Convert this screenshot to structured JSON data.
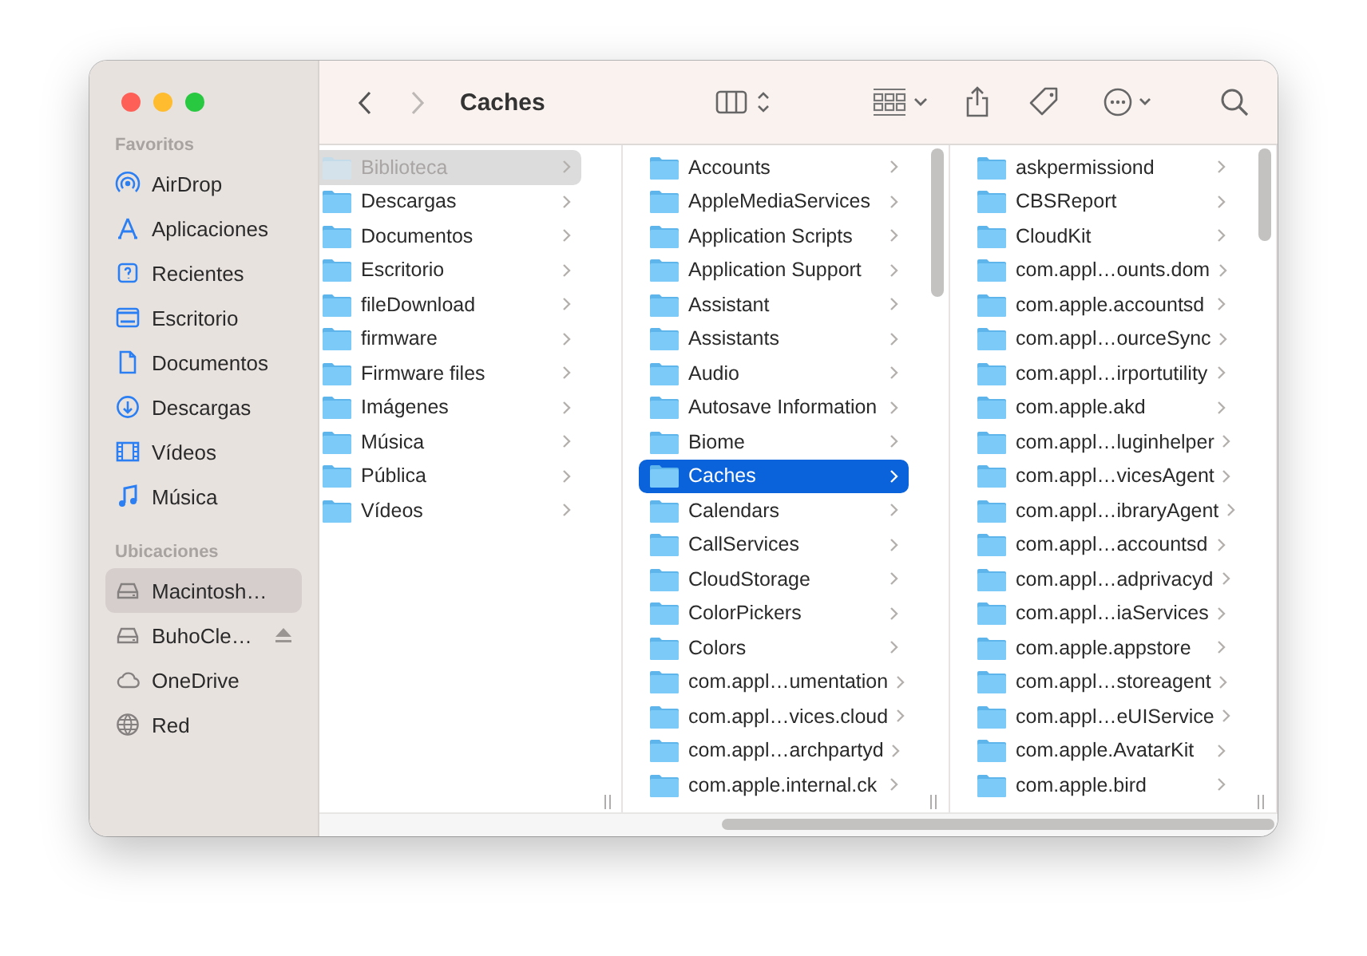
{
  "window": {
    "title": "Caches"
  },
  "toolbar": {
    "back": {
      "disabled": false
    },
    "forward": {
      "disabled": true
    }
  },
  "sidebar": {
    "sections": [
      {
        "heading": "Favoritos",
        "items": [
          {
            "label": "AirDrop",
            "selected": false,
            "ejectable": false
          },
          {
            "label": "Aplicaciones",
            "selected": false,
            "ejectable": false
          },
          {
            "label": "Recientes",
            "selected": false,
            "ejectable": false
          },
          {
            "label": "Escritorio",
            "selected": false,
            "ejectable": false
          },
          {
            "label": "Documentos",
            "selected": false,
            "ejectable": false
          },
          {
            "label": "Descargas",
            "selected": false,
            "ejectable": false
          },
          {
            "label": "Vídeos",
            "selected": false,
            "ejectable": false
          },
          {
            "label": "Música",
            "selected": false,
            "ejectable": false
          }
        ]
      },
      {
        "heading": "Ubicaciones",
        "items": [
          {
            "label": "Macintosh…",
            "selected": true,
            "ejectable": false
          },
          {
            "label": "BuhoCle…",
            "selected": false,
            "ejectable": true
          },
          {
            "label": "OneDrive",
            "selected": false,
            "ejectable": false
          },
          {
            "label": "Red",
            "selected": false,
            "ejectable": false
          }
        ]
      }
    ]
  },
  "columns": [
    {
      "focused": false,
      "items": [
        {
          "name": "Biblioteca",
          "selected": true,
          "dimmed": true
        },
        {
          "name": "Descargas",
          "selected": false,
          "dimmed": false
        },
        {
          "name": "Documentos",
          "selected": false,
          "dimmed": false
        },
        {
          "name": "Escritorio",
          "selected": false,
          "dimmed": false
        },
        {
          "name": "fileDownload",
          "selected": false,
          "dimmed": false
        },
        {
          "name": "firmware",
          "selected": false,
          "dimmed": false
        },
        {
          "name": "Firmware files",
          "selected": false,
          "dimmed": false
        },
        {
          "name": "Imágenes",
          "selected": false,
          "dimmed": false
        },
        {
          "name": "Música",
          "selected": false,
          "dimmed": false
        },
        {
          "name": "Pública",
          "selected": false,
          "dimmed": false
        },
        {
          "name": "Vídeos",
          "selected": false,
          "dimmed": false
        }
      ]
    },
    {
      "focused": true,
      "items": [
        {
          "name": "Accounts",
          "selected": false
        },
        {
          "name": "AppleMediaServices",
          "selected": false
        },
        {
          "name": "Application Scripts",
          "selected": false
        },
        {
          "name": "Application Support",
          "selected": false
        },
        {
          "name": "Assistant",
          "selected": false
        },
        {
          "name": "Assistants",
          "selected": false
        },
        {
          "name": "Audio",
          "selected": false
        },
        {
          "name": "Autosave Information",
          "selected": false
        },
        {
          "name": "Biome",
          "selected": false
        },
        {
          "name": "Caches",
          "selected": true
        },
        {
          "name": "Calendars",
          "selected": false
        },
        {
          "name": "CallServices",
          "selected": false
        },
        {
          "name": "CloudStorage",
          "selected": false
        },
        {
          "name": "ColorPickers",
          "selected": false
        },
        {
          "name": "Colors",
          "selected": false
        },
        {
          "name": "com.appl…umentation",
          "selected": false
        },
        {
          "name": "com.appl…vices.cloud",
          "selected": false
        },
        {
          "name": "com.appl…archpartyd",
          "selected": false
        },
        {
          "name": "com.apple.internal.ck",
          "selected": false
        }
      ]
    },
    {
      "items": [
        {
          "name": "askpermissiond",
          "selected": false
        },
        {
          "name": "CBSReport",
          "selected": false
        },
        {
          "name": "CloudKit",
          "selected": false
        },
        {
          "name": "com.appl…ounts.dom",
          "selected": false
        },
        {
          "name": "com.apple.accountsd",
          "selected": false
        },
        {
          "name": "com.appl…ourceSync",
          "selected": false
        },
        {
          "name": "com.appl…irportutility",
          "selected": false
        },
        {
          "name": "com.apple.akd",
          "selected": false
        },
        {
          "name": "com.appl…luginhelper",
          "selected": false
        },
        {
          "name": "com.appl…vicesAgent",
          "selected": false
        },
        {
          "name": "com.appl…ibraryAgent",
          "selected": false
        },
        {
          "name": "com.appl…accountsd",
          "selected": false
        },
        {
          "name": "com.appl…adprivacyd",
          "selected": false
        },
        {
          "name": "com.appl…iaServices",
          "selected": false
        },
        {
          "name": "com.apple.appstore",
          "selected": false
        },
        {
          "name": "com.appl…storeagent",
          "selected": false
        },
        {
          "name": "com.appl…eUIService",
          "selected": false
        },
        {
          "name": "com.apple.AvatarKit",
          "selected": false
        },
        {
          "name": "com.apple.bird",
          "selected": false
        }
      ]
    }
  ]
}
